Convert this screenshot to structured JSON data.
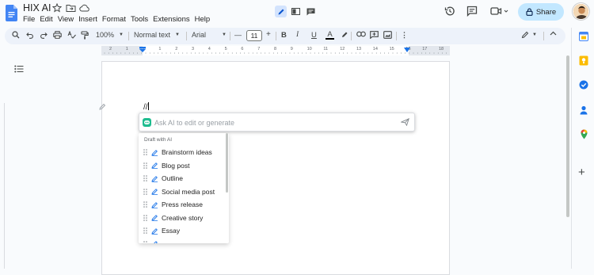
{
  "app": {
    "title": "HIX AI",
    "menu": [
      "File",
      "Edit",
      "View",
      "Insert",
      "Format",
      "Tools",
      "Extensions",
      "Help"
    ]
  },
  "header": {
    "share_label": "Share"
  },
  "toolbar": {
    "zoom": "100%",
    "style": "Normal text",
    "font": "Arial",
    "font_size": "11",
    "minus": "—",
    "plus": "+",
    "bold": "B",
    "italic": "I",
    "underline": "U",
    "text_color": "A",
    "more": "⋮"
  },
  "ruler": {
    "ticks": [
      "2",
      "1",
      "1",
      "1",
      "2",
      "3",
      "4",
      "5",
      "6",
      "7",
      "8",
      "9",
      "10",
      "11",
      "12",
      "13",
      "14",
      "15",
      "16",
      "17",
      "18"
    ]
  },
  "document": {
    "typed_text": "//"
  },
  "ai_prompt": {
    "placeholder": "Ask AI to edit or generate"
  },
  "dropdown": {
    "header": "Draft with AI",
    "items": [
      "Brainstorm ideas",
      "Blog post",
      "Outline",
      "Social media post",
      "Press release",
      "Creative story",
      "Essay"
    ]
  },
  "colors": {
    "accent": "#1a73e8",
    "share_bg": "#c2e7ff",
    "ai_brand": "#1ebc8f",
    "toolbar_bg": "#edf2fa"
  },
  "icons": {
    "doc_logo": "google-docs-icon",
    "star": "star-icon",
    "folder": "move-folder-icon",
    "cloud": "cloud-status-icon",
    "history": "history-icon",
    "comments": "comment-icon",
    "meet": "video-call-icon",
    "lock": "lock-icon"
  }
}
